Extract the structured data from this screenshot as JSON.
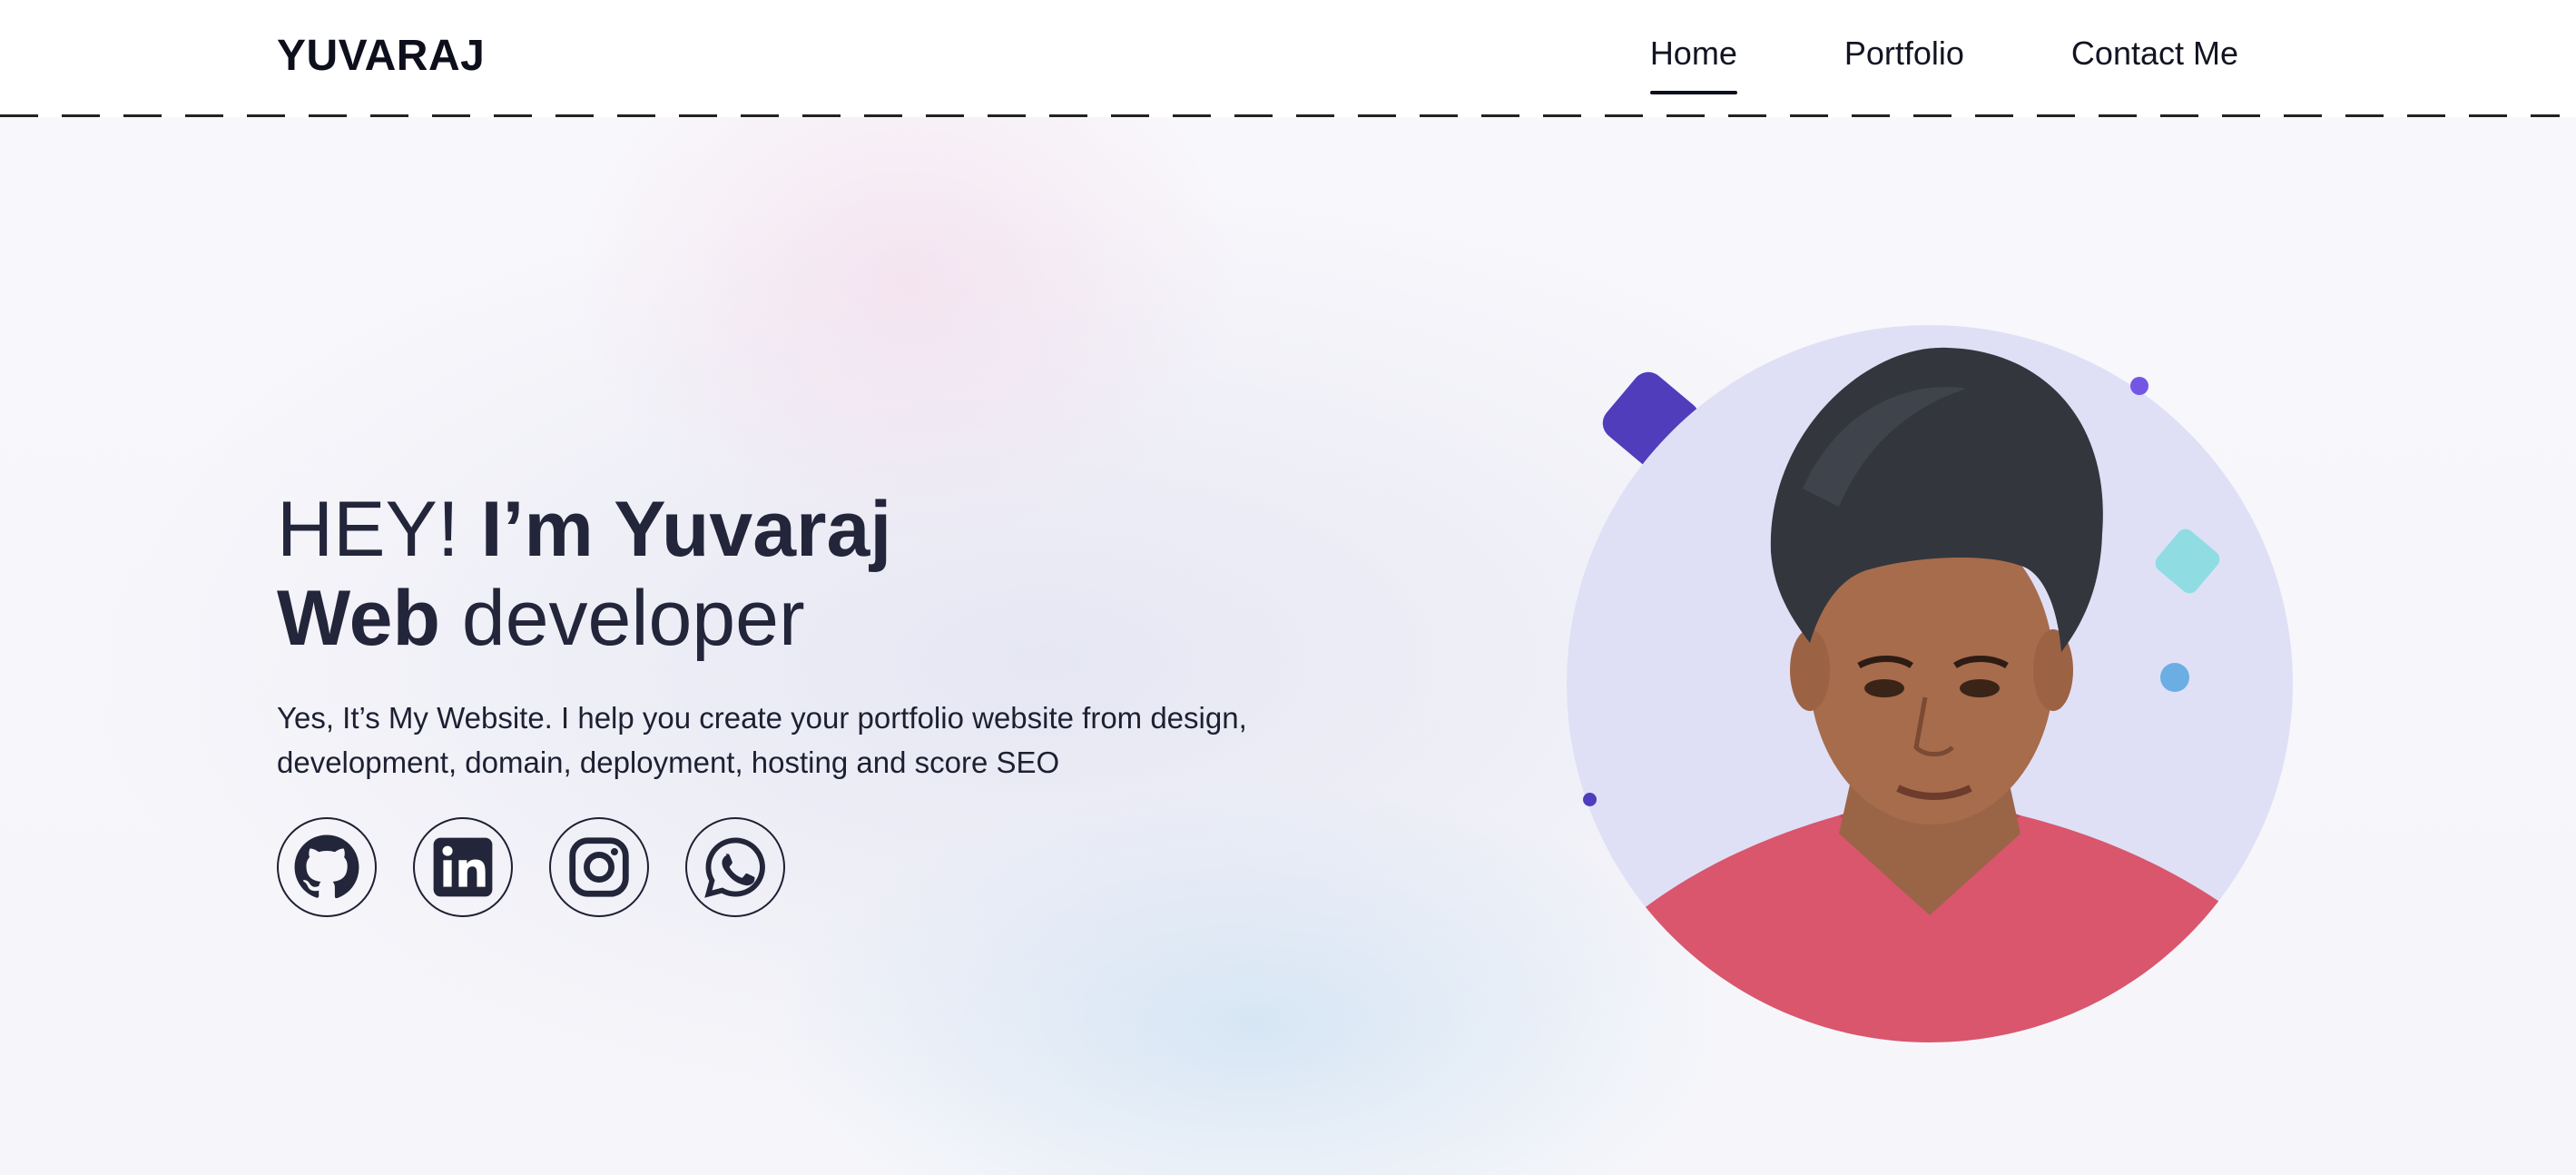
{
  "header": {
    "logo": "YUVARAJ",
    "nav": [
      {
        "label": "Home",
        "active": true
      },
      {
        "label": "Portfolio",
        "active": false
      },
      {
        "label": "Contact Me",
        "active": false
      }
    ]
  },
  "hero": {
    "greeting_light": "HEY! ",
    "greeting_bold": "I’m Yuvaraj",
    "role_bold": "Web",
    "role_light": " developer",
    "description_line1": "Yes, It’s My Website. I help you create your portfolio website from design,",
    "description_line2": "development, domain, deployment, hosting and score SEO",
    "socials": [
      {
        "icon": "github-icon"
      },
      {
        "icon": "linkedin-icon"
      },
      {
        "icon": "instagram-icon"
      },
      {
        "icon": "whatsapp-icon"
      }
    ]
  },
  "colors": {
    "text_dark": "#23263a",
    "accent_purple": "#4f3dbc",
    "accent_cyan": "#8fdde3",
    "avatar_bg": "#dfe0f6"
  }
}
